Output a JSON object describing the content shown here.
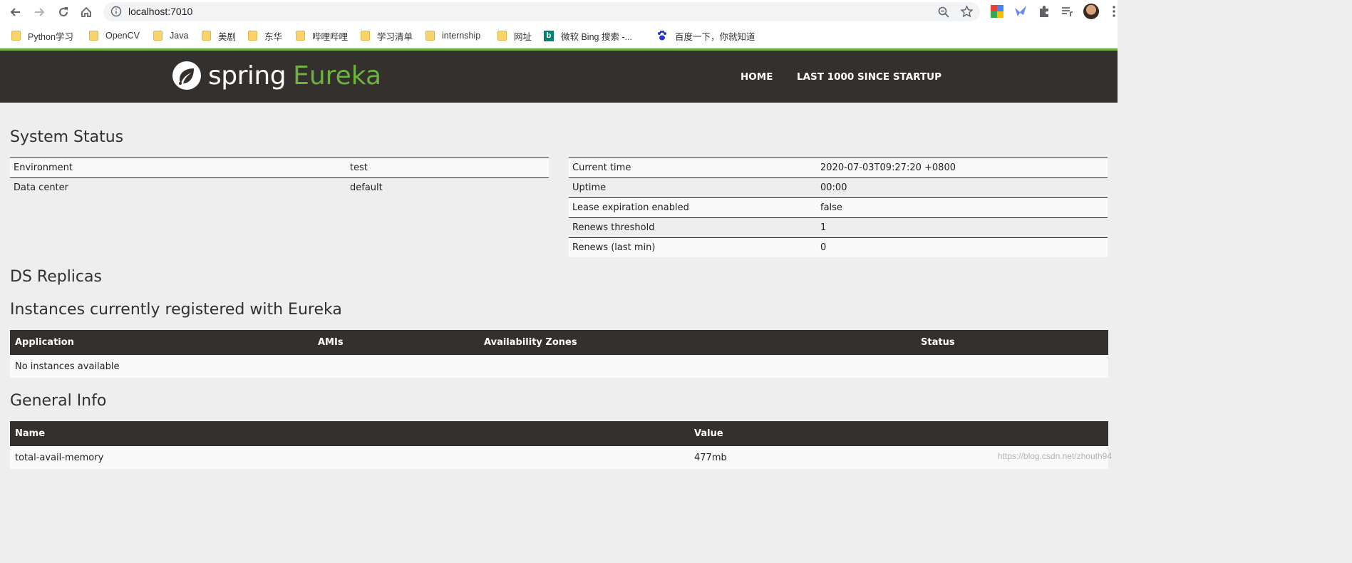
{
  "browser": {
    "url": "localhost:7010",
    "bookmarks": [
      {
        "label": "Python学习",
        "icon": "folder-icon"
      },
      {
        "label": "OpenCV",
        "icon": "folder-icon"
      },
      {
        "label": "Java",
        "icon": "folder-icon"
      },
      {
        "label": "美剧",
        "icon": "folder-icon"
      },
      {
        "label": "东华",
        "icon": "folder-icon"
      },
      {
        "label": "哔哩哔哩",
        "icon": "folder-icon"
      },
      {
        "label": "学习清单",
        "icon": "folder-icon"
      },
      {
        "label": "internship",
        "icon": "folder-icon"
      },
      {
        "label": "网址",
        "icon": "folder-icon"
      },
      {
        "label": "微软 Bing 搜索 -...",
        "icon": "bing-icon"
      },
      {
        "label": "百度一下，你就知道",
        "icon": "baidu-paw-icon"
      }
    ]
  },
  "header": {
    "brand_spring": "spring",
    "brand_eureka": "Eureka",
    "nav": {
      "home": "HOME",
      "last1000": "LAST 1000 SINCE STARTUP"
    },
    "accent_color": "#6db33f",
    "bg_color": "#34302d"
  },
  "system_status": {
    "title": "System Status",
    "left": [
      {
        "label": "Environment",
        "value": "test"
      },
      {
        "label": "Data center",
        "value": "default"
      }
    ],
    "right": [
      {
        "label": "Current time",
        "value": "2020-07-03T09:27:20 +0800"
      },
      {
        "label": "Uptime",
        "value": "00:00"
      },
      {
        "label": "Lease expiration enabled",
        "value": "false"
      },
      {
        "label": "Renews threshold",
        "value": "1"
      },
      {
        "label": "Renews (last min)",
        "value": "0"
      }
    ]
  },
  "ds_replicas": {
    "title": "DS Replicas"
  },
  "instances": {
    "title": "Instances currently registered with Eureka",
    "columns": [
      "Application",
      "AMIs",
      "Availability Zones",
      "Status"
    ],
    "empty_message": "No instances available"
  },
  "general_info": {
    "title": "General Info",
    "columns": [
      "Name",
      "Value"
    ],
    "rows": [
      {
        "name": "total-avail-memory",
        "value": "477mb"
      }
    ]
  },
  "watermark": "https://blog.csdn.net/zhouth94"
}
